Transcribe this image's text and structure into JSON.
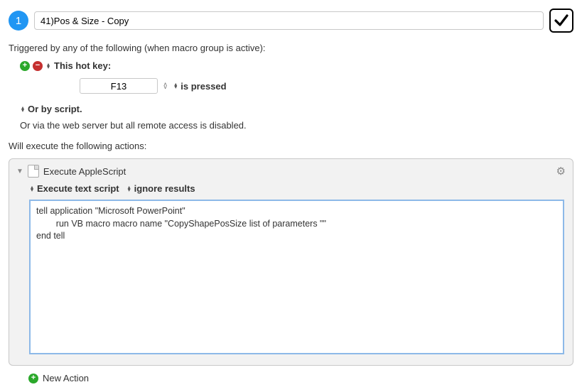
{
  "header": {
    "badge": "1",
    "title": "41)Pos & Size - Copy"
  },
  "triggers": {
    "intro": "Triggered by any of the following (when macro group is active):",
    "hotkey_label": "This hot key:",
    "hotkey_value": "F13",
    "hotkey_mode": "is pressed",
    "script_label": "Or by script.",
    "webserver_text": "Or via the web server but all remote access is disabled."
  },
  "actions": {
    "intro": "Will execute the following actions:",
    "item": {
      "title": "Execute AppleScript",
      "option1": "Execute text script",
      "option2": "ignore results",
      "script": "tell application \"Microsoft PowerPoint\"\n        run VB macro macro name \"CopyShapePosSize list of parameters \"\"\nend tell"
    },
    "new_action": "New Action"
  }
}
